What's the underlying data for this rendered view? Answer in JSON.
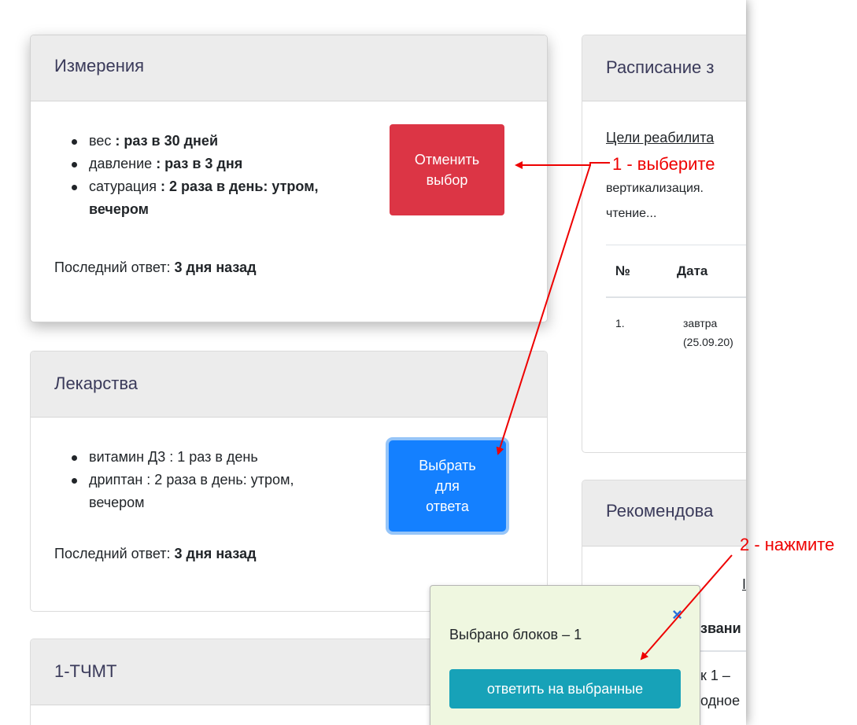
{
  "measurements": {
    "title": "Измерения",
    "items": [
      {
        "name": "вес",
        "schedule": " : раз в 30 дней"
      },
      {
        "name": "давление",
        "schedule": " : раз в 3 дня"
      },
      {
        "name": "сатурация",
        "schedule": " : 2 раза в день: утром, вечером"
      }
    ],
    "last_answer_label": "Последний ответ: ",
    "last_answer_value": "3 дня назад",
    "cancel_button_line1": "Отменить",
    "cancel_button_line2": "выбор"
  },
  "medicines": {
    "title": "Лекарства",
    "items": [
      {
        "text": "витамин Д3 : 1 раз в день"
      },
      {
        "text": "дриптан : 2 раза в день: утром, вечером"
      }
    ],
    "last_answer_label": "Последний ответ: ",
    "last_answer_value": "3 дня назад",
    "select_button_line1": "Выбрать",
    "select_button_line2": "для",
    "select_button_line3": "ответа"
  },
  "tchmt": {
    "title": "1-ТЧМТ"
  },
  "schedule": {
    "title": "Расписание з",
    "goals_link": "Цели реабилита",
    "goals_text_line1": "вертикализация.",
    "goals_text_line2": "чтение...",
    "table": {
      "headers": [
        "№",
        "Дата"
      ],
      "rows": [
        {
          "num": "1.",
          "date_line1": "завтра",
          "date_line2": "(25.09.20)"
        }
      ]
    }
  },
  "recommendations": {
    "title": "Рекомендова",
    "fragment_char": "I",
    "fragment_bold": "звани",
    "fragment_line1": "к 1 –",
    "fragment_line2": "одное"
  },
  "popup": {
    "selected_text": "Выбрано блоков – 1",
    "close_icon": "×",
    "answer_button": "ответить на выбранные"
  },
  "annotations": {
    "step1": "1 - выберите",
    "step2": "2 - нажмите",
    "color": "#ee0000"
  },
  "colors": {
    "cancel_red": "#dc3545",
    "select_blue": "#1480ff",
    "answer_teal": "#17a2b8",
    "popup_bg": "#eff7e0"
  }
}
